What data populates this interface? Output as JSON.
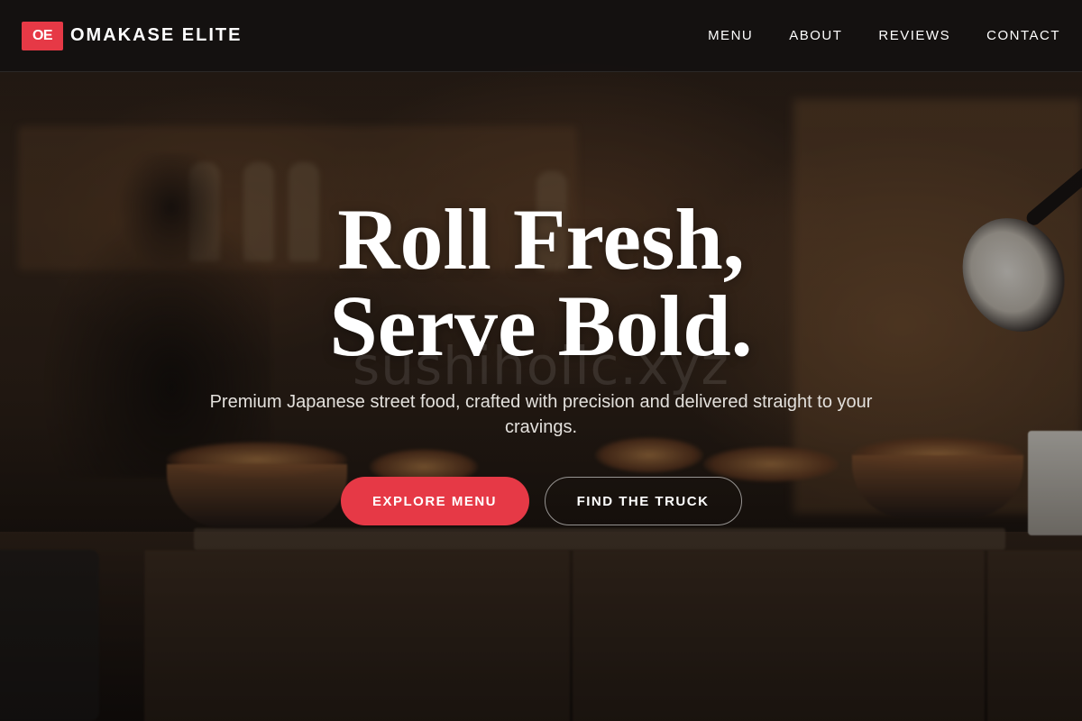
{
  "header": {
    "logo_badge": "OE",
    "brand_name": "OMAKASE ELITE",
    "nav": [
      {
        "label": "MENU"
      },
      {
        "label": "ABOUT"
      },
      {
        "label": "REVIEWS"
      },
      {
        "label": "CONTACT"
      }
    ]
  },
  "hero": {
    "title_line1": "Roll Fresh,",
    "title_line2": "Serve Bold.",
    "watermark": "sushiholic.xyz",
    "subtitle": "Premium Japanese street food, crafted with precision and delivered straight to your cravings.",
    "primary_cta": "EXPLORE MENU",
    "secondary_cta": "FIND THE TRUCK"
  },
  "colors": {
    "accent": "#e63946",
    "header_bg": "#121010",
    "text": "#ffffff"
  }
}
